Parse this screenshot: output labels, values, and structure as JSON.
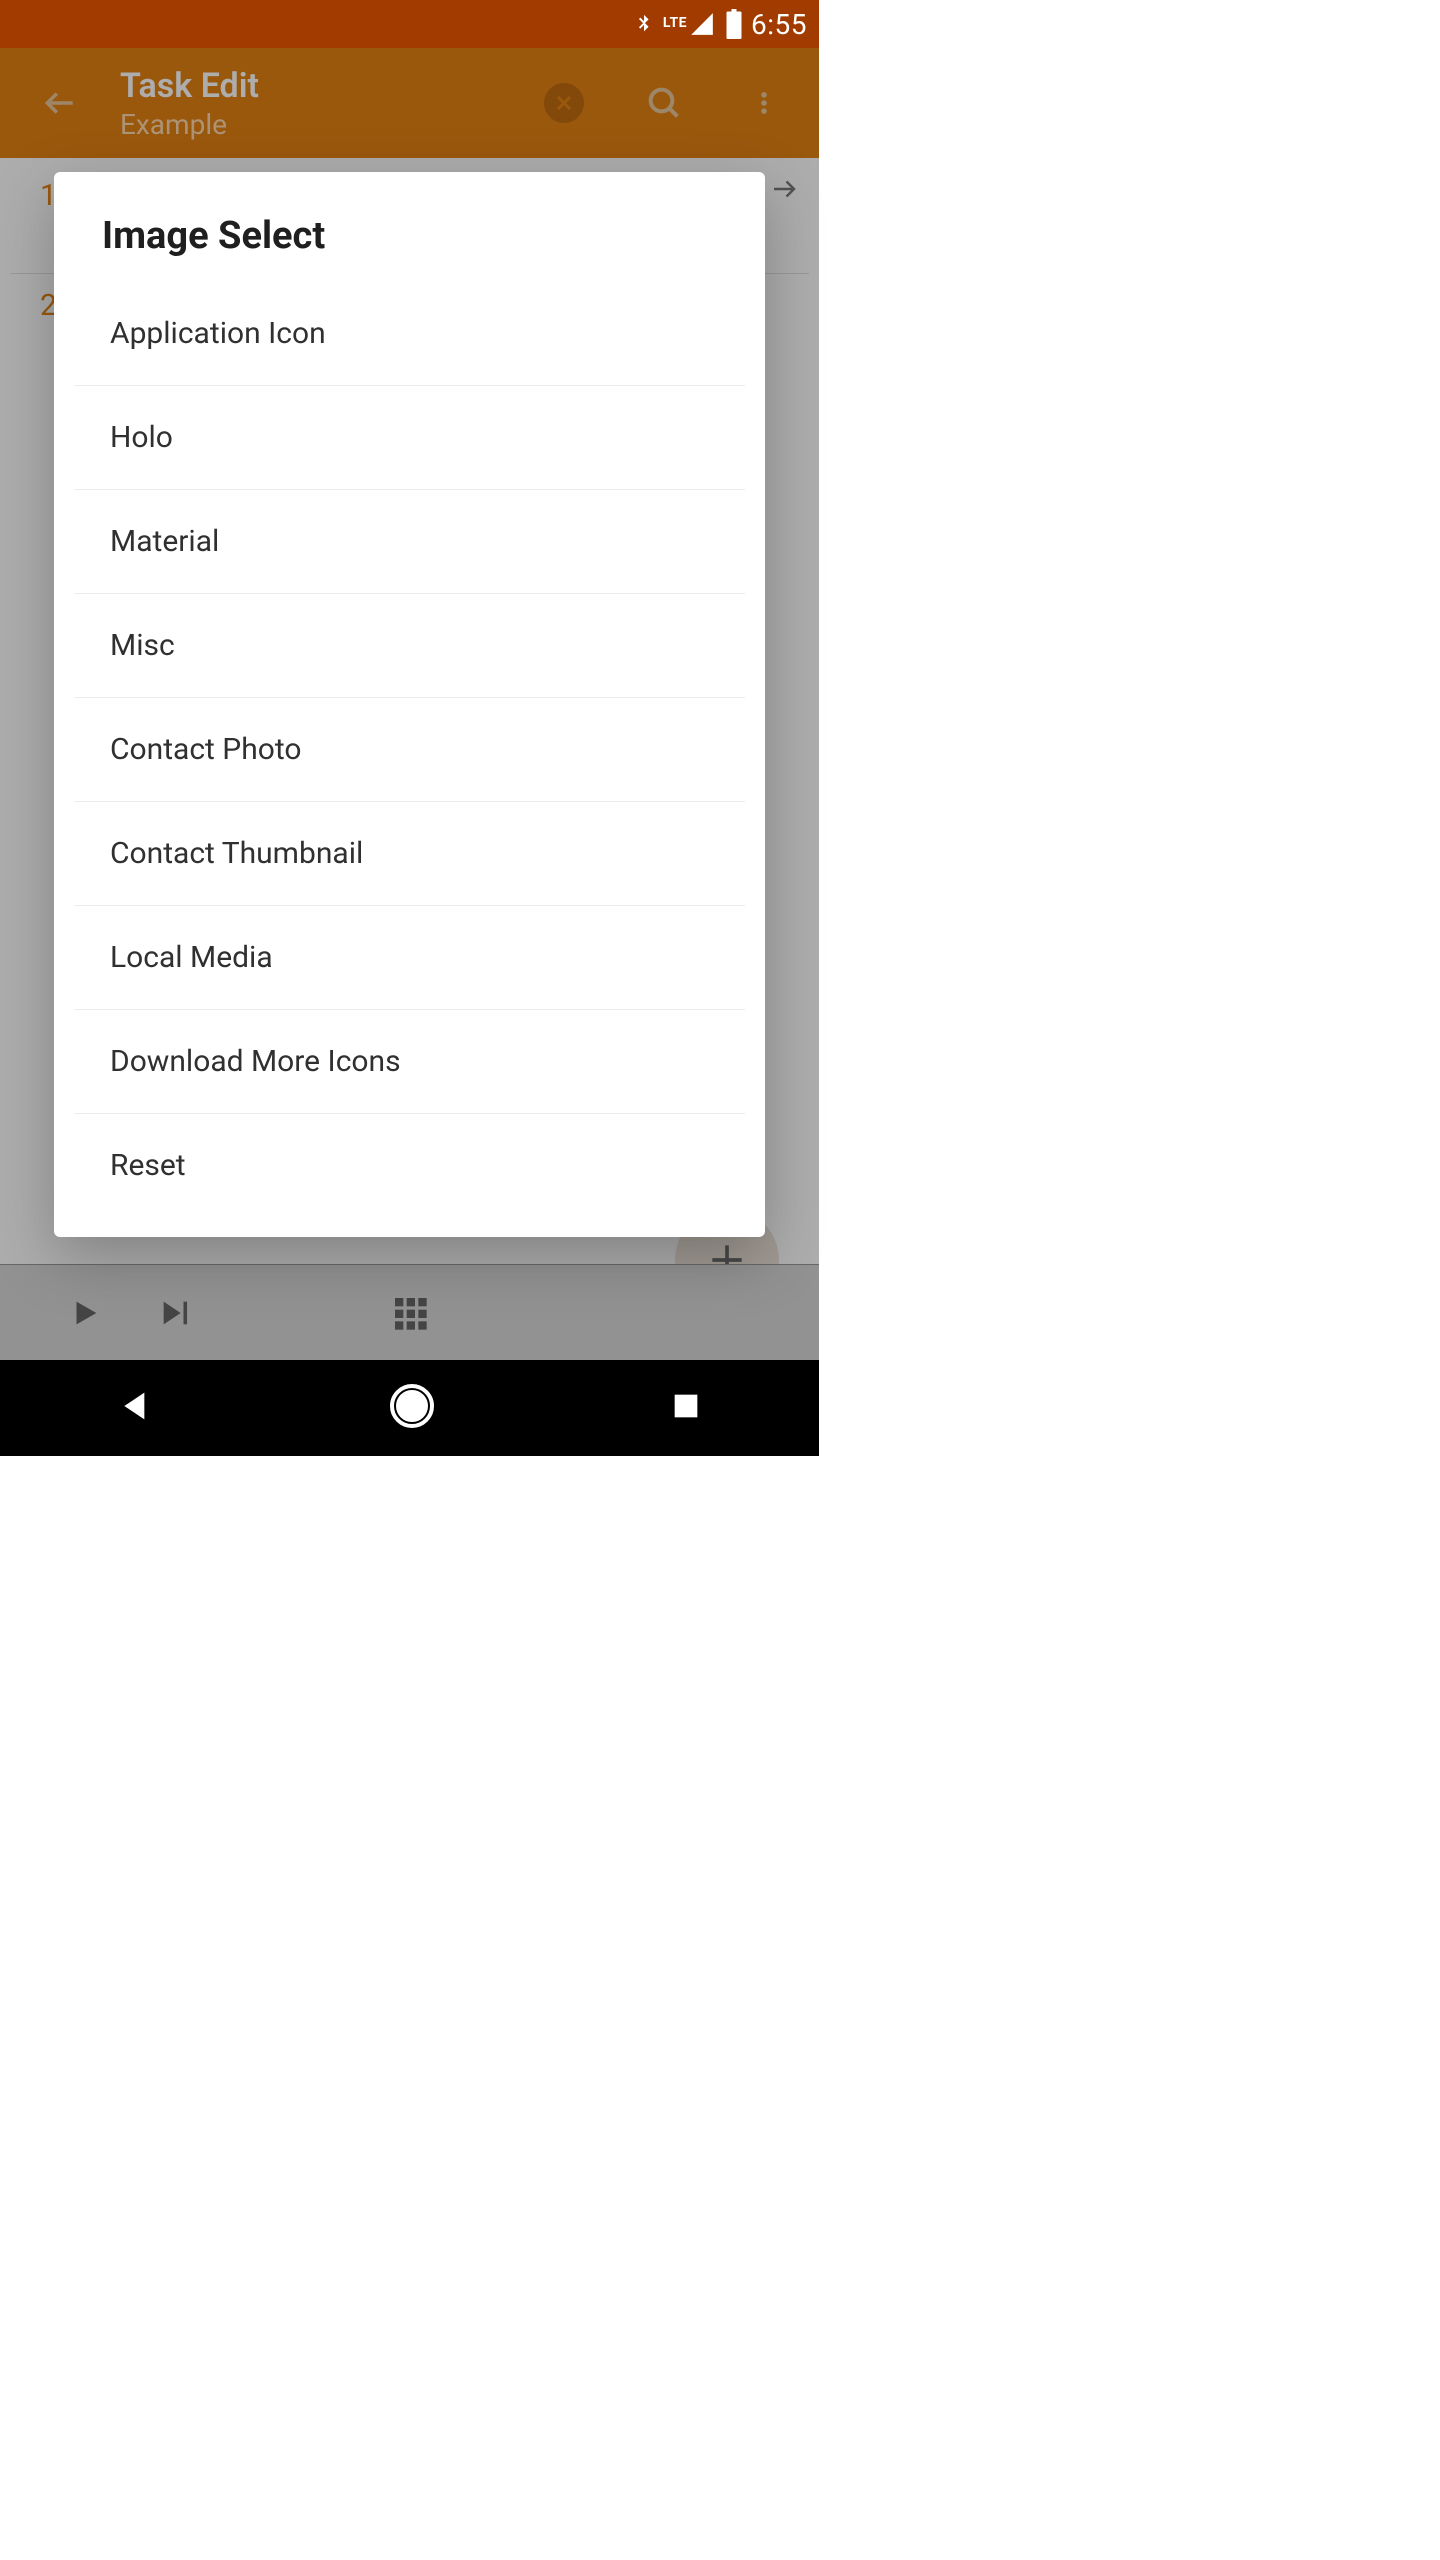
{
  "status": {
    "network_label": "LTE",
    "time": "6:55"
  },
  "appbar": {
    "title": "Task Edit",
    "subtitle": "Example"
  },
  "content": {
    "step1": "1",
    "step2": "2"
  },
  "dialog": {
    "title": "Image Select",
    "items": [
      "Application Icon",
      "Holo",
      "Material",
      "Misc",
      "Contact Photo",
      "Contact Thumbnail",
      "Local Media",
      "Download More Icons",
      "Reset"
    ]
  }
}
